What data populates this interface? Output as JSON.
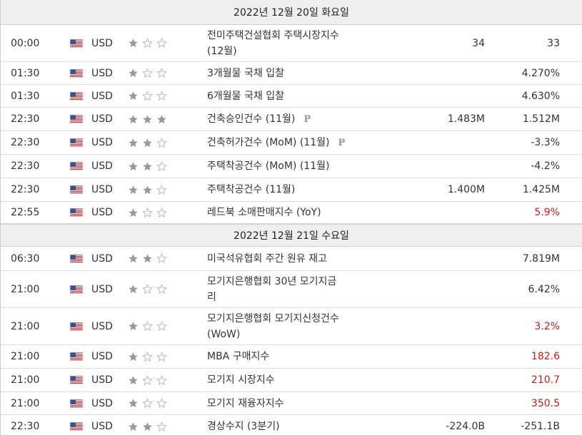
{
  "sections": [
    {
      "date": "2022년 12월 20일 화요일",
      "events": [
        {
          "time": "00:00",
          "currency": "USD",
          "importance": 1,
          "event_line1": "전미주택건설협회 주택시장지수",
          "event_line2": "(12월)",
          "forecast": "34",
          "previous": "33",
          "prev_red": false,
          "badge": ""
        },
        {
          "time": "01:30",
          "currency": "USD",
          "importance": 1,
          "event_line1": "3개월물 국채 입찰",
          "event_line2": "",
          "forecast": "",
          "previous": "4.270%",
          "prev_red": false,
          "badge": ""
        },
        {
          "time": "01:30",
          "currency": "USD",
          "importance": 1,
          "event_line1": "6개월물 국채 입찰",
          "event_line2": "",
          "forecast": "",
          "previous": "4.630%",
          "prev_red": false,
          "badge": ""
        },
        {
          "time": "22:30",
          "currency": "USD",
          "importance": 3,
          "event_line1": "건축승인건수 (11월)",
          "event_line2": "",
          "forecast": "1.483M",
          "previous": "1.512M",
          "prev_red": false,
          "badge": "P"
        },
        {
          "time": "22:30",
          "currency": "USD",
          "importance": 2,
          "event_line1": "건축허가건수 (MoM) (11월)",
          "event_line2": "",
          "forecast": "",
          "previous": "-3.3%",
          "prev_red": false,
          "badge": "P"
        },
        {
          "time": "22:30",
          "currency": "USD",
          "importance": 2,
          "event_line1": "주택착공건수 (MoM) (11월)",
          "event_line2": "",
          "forecast": "",
          "previous": "-4.2%",
          "prev_red": false,
          "badge": ""
        },
        {
          "time": "22:30",
          "currency": "USD",
          "importance": 2,
          "event_line1": "주택착공건수 (11월)",
          "event_line2": "",
          "forecast": "1.400M",
          "previous": "1.425M",
          "prev_red": false,
          "badge": ""
        },
        {
          "time": "22:55",
          "currency": "USD",
          "importance": 1,
          "event_line1": "레드북 소매판매지수 (YoY)",
          "event_line2": "",
          "forecast": "",
          "previous": "5.9%",
          "prev_red": true,
          "badge": ""
        }
      ]
    },
    {
      "date": "2022년 12월 21일 수요일",
      "events": [
        {
          "time": "06:30",
          "currency": "USD",
          "importance": 2,
          "event_line1": "미국석유협회 주간 원유 재고",
          "event_line2": "",
          "forecast": "",
          "previous": "7.819M",
          "prev_red": false,
          "badge": ""
        },
        {
          "time": "21:00",
          "currency": "USD",
          "importance": 1,
          "event_line1": "모기지은행협회 30년 모기지금",
          "event_line2": "리",
          "forecast": "",
          "previous": "6.42%",
          "prev_red": false,
          "badge": ""
        },
        {
          "time": "21:00",
          "currency": "USD",
          "importance": 1,
          "event_line1": "모기지은행협회 모기지신청건수",
          "event_line2": "(WoW)",
          "forecast": "",
          "previous": "3.2%",
          "prev_red": true,
          "badge": ""
        },
        {
          "time": "21:00",
          "currency": "USD",
          "importance": 1,
          "event_line1": "MBA 구매지수",
          "event_line2": "",
          "forecast": "",
          "previous": "182.6",
          "prev_red": true,
          "badge": ""
        },
        {
          "time": "21:00",
          "currency": "USD",
          "importance": 1,
          "event_line1": "모기지 시장지수",
          "event_line2": "",
          "forecast": "",
          "previous": "210.7",
          "prev_red": true,
          "badge": ""
        },
        {
          "time": "21:00",
          "currency": "USD",
          "importance": 1,
          "event_line1": "모기지 재융자지수",
          "event_line2": "",
          "forecast": "",
          "previous": "350.5",
          "prev_red": true,
          "badge": ""
        },
        {
          "time": "22:30",
          "currency": "USD",
          "importance": 2,
          "event_line1": "경상수지 (3분기)",
          "event_line2": "",
          "forecast": "-224.0B",
          "previous": "-251.1B",
          "prev_red": false,
          "badge": ""
        }
      ]
    }
  ],
  "colors": {
    "star_filled": "#999999",
    "star_empty": "#bbbbbb",
    "red": "#cc1a1a",
    "date_bg": "#efefef"
  },
  "icons": {
    "flag": "us-flag-icon",
    "star_filled": "star-filled-icon",
    "star_empty": "star-empty-icon",
    "badge": "preliminary-badge-icon"
  }
}
